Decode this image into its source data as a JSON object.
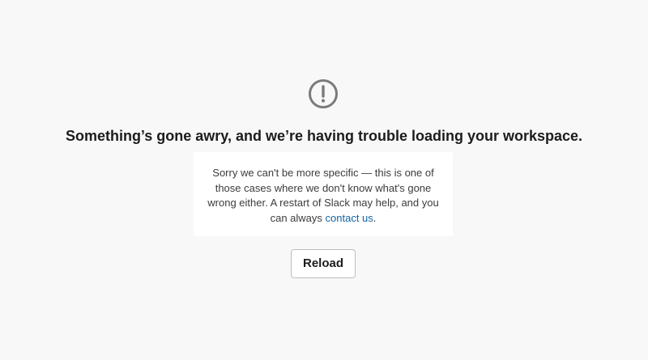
{
  "error": {
    "icon": "exclamation-circle-icon",
    "icon_color": "#7b7b7b",
    "title": "Something’s gone awry, and we’re having trouble loading your workspace.",
    "message_before_link": "Sorry we can't be more specific — this is one of those cases where we don't know what's gone wrong either. A restart of Slack may help, and you can always ",
    "link_text": "contact us",
    "message_after_link": ".",
    "link_color": "#1264a3",
    "reload_label": "Reload"
  }
}
